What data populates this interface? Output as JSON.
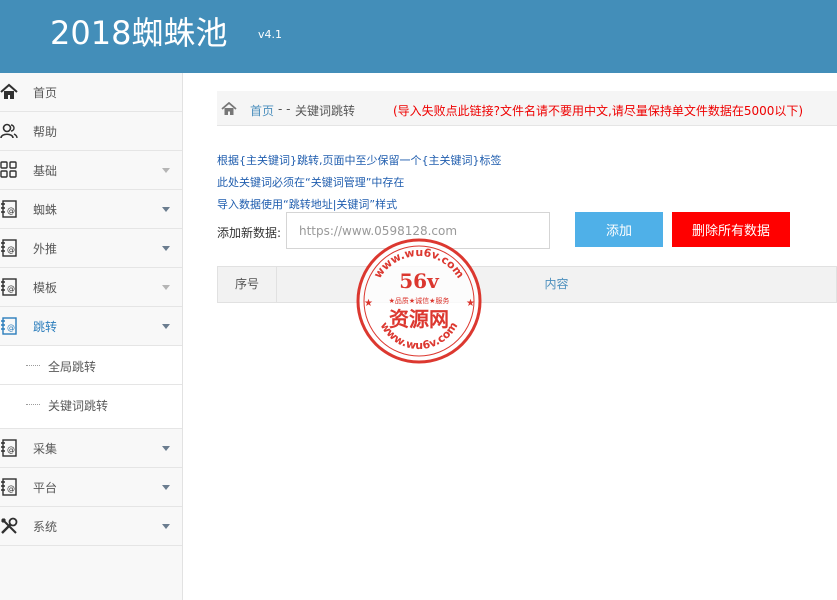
{
  "header": {
    "title": "2018蜘蛛池",
    "version": "v4.1"
  },
  "sidebar": {
    "items": [
      {
        "label": "首页",
        "icon": "home-icon",
        "caret": false
      },
      {
        "label": "帮助",
        "icon": "users-icon",
        "caret": false
      },
      {
        "label": "基础",
        "icon": "grid-icon",
        "caret": true
      },
      {
        "label": "蜘蛛",
        "icon": "contact-book-icon",
        "caret": true
      },
      {
        "label": "外推",
        "icon": "contact-book-icon",
        "caret": true
      },
      {
        "label": "模板",
        "icon": "contact-book-icon",
        "caret": true
      },
      {
        "label": "跳转",
        "icon": "contact-book-icon",
        "caret": true
      },
      {
        "label": "采集",
        "icon": "contact-book-icon",
        "caret": true
      },
      {
        "label": "平台",
        "icon": "contact-book-icon",
        "caret": true
      },
      {
        "label": "系统",
        "icon": "tools-icon",
        "caret": true
      }
    ],
    "subitems": [
      {
        "label": "全局跳转"
      },
      {
        "label": "关键词跳转"
      }
    ]
  },
  "breadcrumb": {
    "home": "首页",
    "separator": "- -",
    "current": "关键词跳转",
    "link": "(导入失败点此链接?文件名请不要用中文,请尽量保持单文件数据在5000以下)"
  },
  "info": {
    "line1": "根据{主关键词}跳转,页面中至少保留一个{主关键词}标签",
    "line2": "此处关键词必须在“关键词管理”中存在",
    "line3": "导入数据使用“跳转地址|关键词”样式"
  },
  "form": {
    "label": "添加新数据:",
    "placeholder": "https://www.0598128.com",
    "add_button": "添加",
    "delete_all_button": "删除所有数据"
  },
  "table": {
    "columns": [
      "序号",
      "内容"
    ]
  },
  "watermark": {
    "top_text": "www.wu6v.com",
    "bottom_text": "www.wu6v.com",
    "center_big": "56v",
    "center_small": "★品质★诚信★服务",
    "center_main": "资源网"
  },
  "colors": {
    "header_bg": "#438eb9",
    "accent_blue": "#4c8fbd",
    "add_button": "#4fb0e8",
    "delete_button": "#ff0000",
    "warning_text": "#ee0000",
    "info_text": "#1f5dae",
    "stamp_red": "#d9231a"
  }
}
